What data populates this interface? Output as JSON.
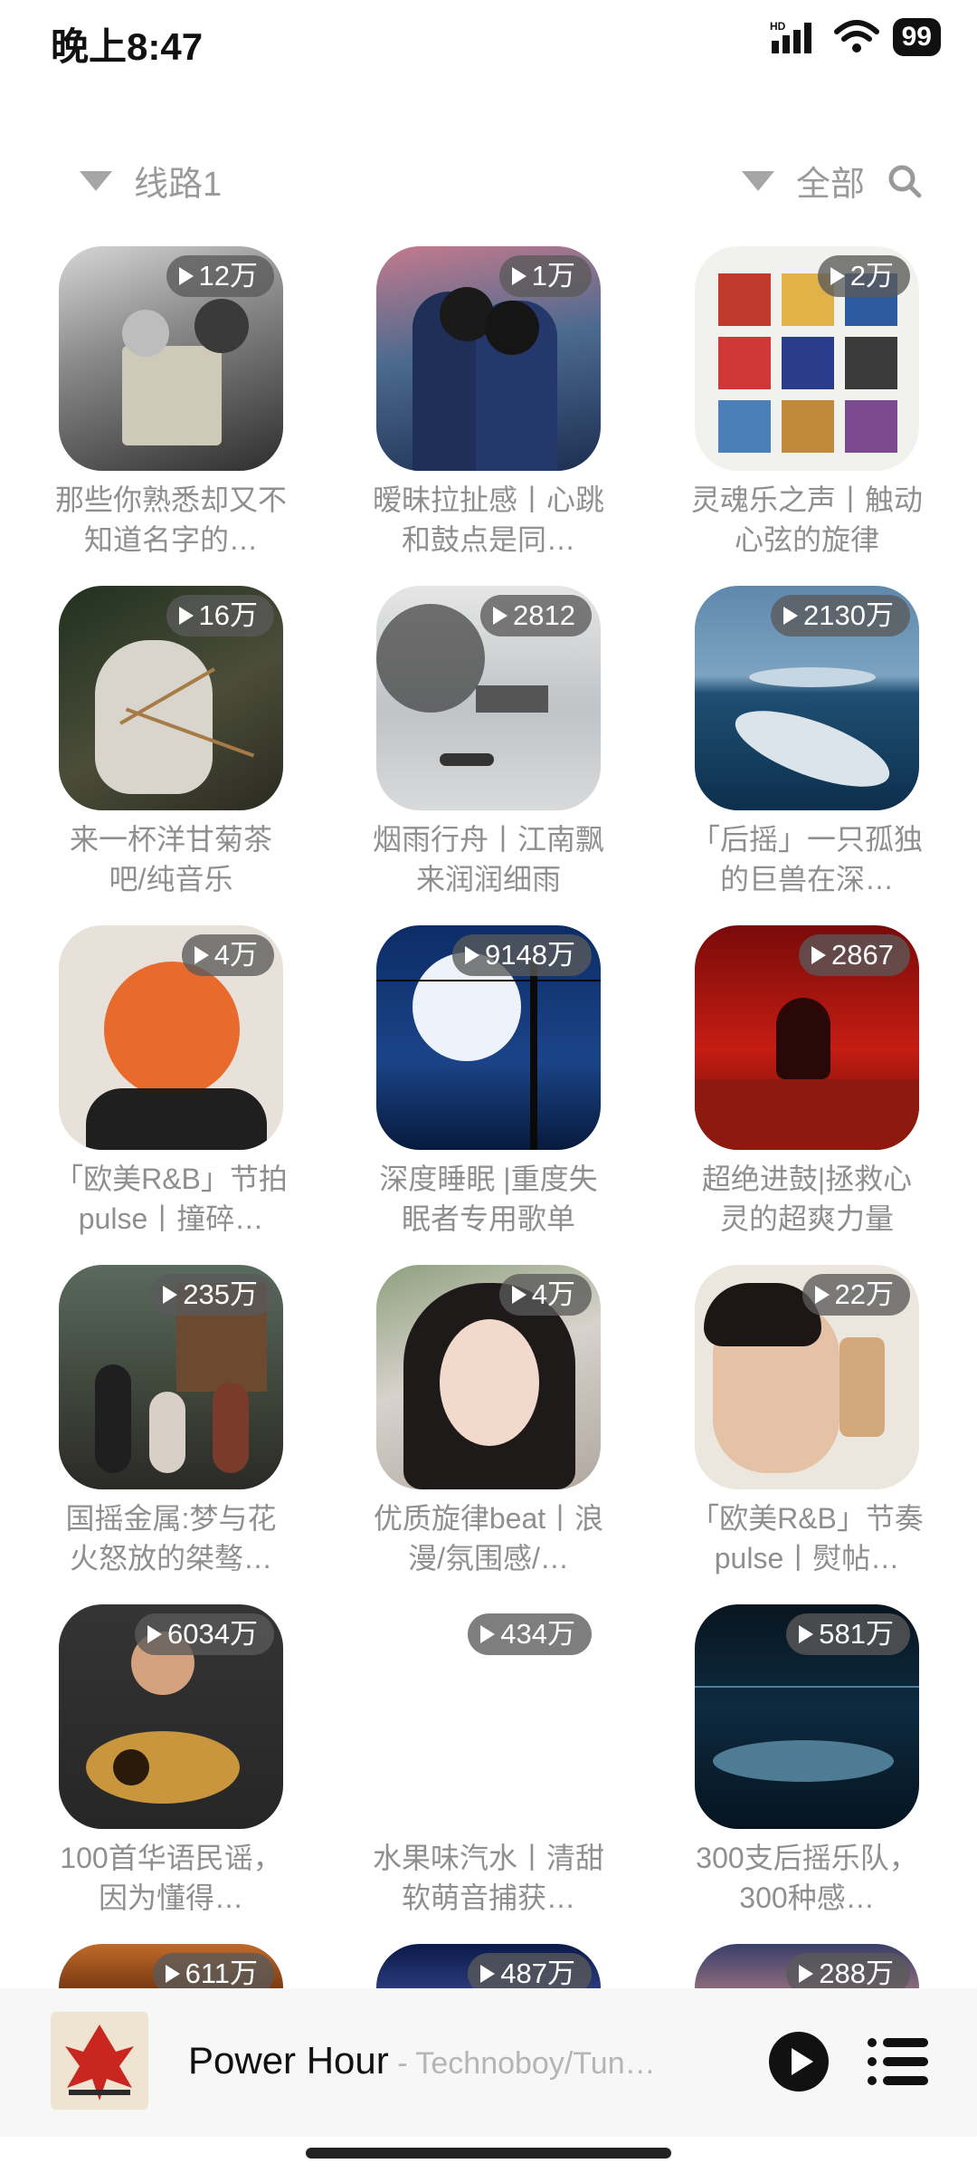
{
  "status": {
    "time": "晚上8:47",
    "battery": "99",
    "network_label": "HD"
  },
  "toolbar": {
    "route_label": "线路1",
    "filter_label": "全部"
  },
  "playlists": [
    {
      "count": "12万",
      "title": "那些你熟悉却又不知道名字的…",
      "cover": "bw-book"
    },
    {
      "count": "1万",
      "title": "暧昧拉扯感丨心跳和鼓点是同…",
      "cover": "kiss"
    },
    {
      "count": "2万",
      "title": "灵魂乐之声丨触动心弦的旋律",
      "cover": "albums"
    },
    {
      "count": "16万",
      "title": "来一杯洋甘菊茶吧/纯音乐",
      "cover": "cat"
    },
    {
      "count": "2812",
      "title": "烟雨行舟丨江南飘来润润细雨",
      "cover": "ink"
    },
    {
      "count": "2130万",
      "title": "「后摇」一只孤独的巨兽在深…",
      "cover": "whale"
    },
    {
      "count": "4万",
      "title": "「欧美R&B」节拍pulse丨撞碎…",
      "cover": "orange-hair"
    },
    {
      "count": "9148万",
      "title": "深度睡眠 |重度失眠者专用歌单",
      "cover": "moon"
    },
    {
      "count": "2867",
      "title": "超绝进鼓|拯救心灵的超爽力量",
      "cover": "red"
    },
    {
      "count": "235万",
      "title": "国摇金属:梦与花火怒放的桀骜…",
      "cover": "band"
    },
    {
      "count": "4万",
      "title": "优质旋律beat丨浪漫/氛围感/…",
      "cover": "girl"
    },
    {
      "count": "22万",
      "title": "「欧美R&B」节奏pulse丨熨帖…",
      "cover": "selfie"
    },
    {
      "count": "6034万",
      "title": "100首华语民谣，因为懂得…",
      "cover": "guitar"
    },
    {
      "count": "434万",
      "title": "水果味汽水丨清甜软萌音捕获…",
      "cover": "blank"
    },
    {
      "count": "581万",
      "title": "300支后摇乐队，300种感…",
      "cover": "deep-whale"
    },
    {
      "count": "611万",
      "title": "",
      "cover": "brown"
    },
    {
      "count": "487万",
      "title": "",
      "cover": "navy"
    },
    {
      "count": "288万",
      "title": "",
      "cover": "dusk"
    }
  ],
  "player": {
    "title": "Power Hour",
    "separator": " - ",
    "artist": "Technoboy/Tun…"
  }
}
